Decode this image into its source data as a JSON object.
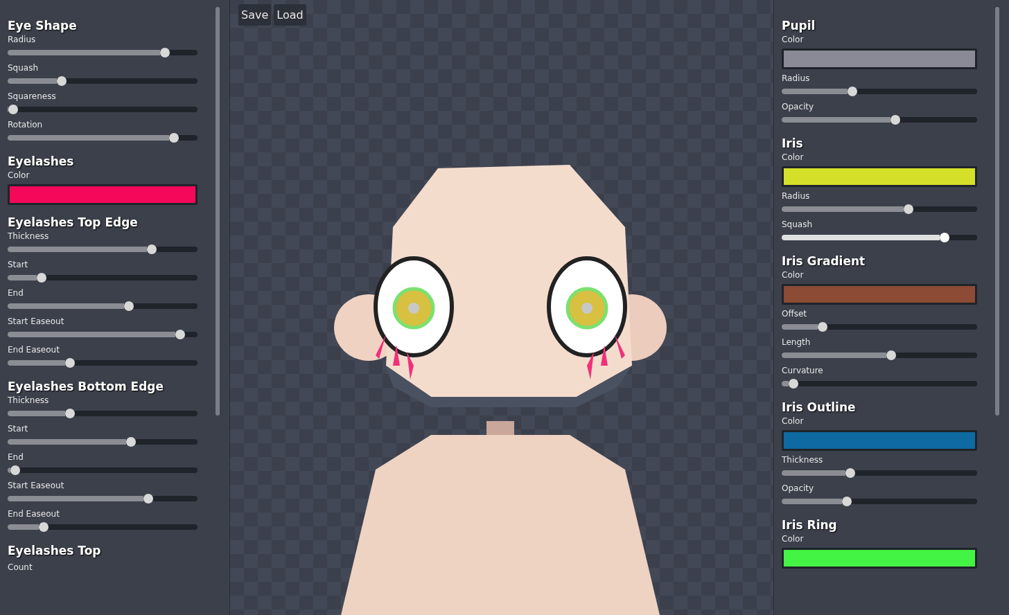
{
  "left_panel": {
    "sections": [
      {
        "title": "Eye Shape",
        "controls": [
          {
            "kind": "slider",
            "label": "Radius",
            "level": 0.83,
            "active": false
          },
          {
            "kind": "slider",
            "label": "Squash",
            "level": 0.285,
            "active": false
          },
          {
            "kind": "slider",
            "label": "Squareness",
            "level": 0.03,
            "active": false
          },
          {
            "kind": "slider",
            "label": "Rotation",
            "level": 0.875,
            "active": false
          }
        ]
      },
      {
        "title": "Eyelashes",
        "controls": [
          {
            "kind": "color",
            "label": "Color",
            "color": "#f5075a"
          }
        ]
      },
      {
        "title": "Eyelashes Top Edge",
        "controls": [
          {
            "kind": "slider",
            "label": "Thickness",
            "level": 0.76,
            "active": false
          },
          {
            "kind": "slider",
            "label": "Start",
            "level": 0.18,
            "active": false
          },
          {
            "kind": "slider",
            "label": "End",
            "level": 0.64,
            "active": false
          },
          {
            "kind": "slider",
            "label": "Start Easeout",
            "level": 0.91,
            "active": false
          },
          {
            "kind": "slider",
            "label": "End Easeout",
            "level": 0.33,
            "active": false
          }
        ]
      },
      {
        "title": "Eyelashes Bottom Edge",
        "controls": [
          {
            "kind": "slider",
            "label": "Thickness",
            "level": 0.33,
            "active": false
          },
          {
            "kind": "slider",
            "label": "Start",
            "level": 0.65,
            "active": false
          },
          {
            "kind": "slider",
            "label": "End",
            "level": 0.04,
            "active": false
          },
          {
            "kind": "slider",
            "label": "Start Easeout",
            "level": 0.74,
            "active": false
          },
          {
            "kind": "slider",
            "label": "End Easeout",
            "level": 0.19,
            "active": false
          }
        ]
      },
      {
        "title": "Eyelashes Top",
        "controls": [
          {
            "kind": "label",
            "label": "Count"
          }
        ]
      }
    ]
  },
  "viewport": {
    "buttons": [
      "Save",
      "Load"
    ]
  },
  "right_panel": {
    "sections": [
      {
        "title": "Pupil",
        "controls": [
          {
            "kind": "color",
            "label": "Color",
            "color": "#8a8a96"
          },
          {
            "kind": "slider",
            "label": "Radius",
            "level": 0.36,
            "active": false
          },
          {
            "kind": "slider",
            "label": "Opacity",
            "level": 0.58,
            "active": false
          }
        ]
      },
      {
        "title": "Iris",
        "controls": [
          {
            "kind": "color",
            "label": "Color",
            "color": "#d4e02a"
          },
          {
            "kind": "slider",
            "label": "Radius",
            "level": 0.65,
            "active": false
          },
          {
            "kind": "slider",
            "label": "Squash",
            "level": 0.835,
            "active": true
          }
        ]
      },
      {
        "title": "Iris Gradient",
        "controls": [
          {
            "kind": "color",
            "label": "Color",
            "color": "#8b4b35"
          },
          {
            "kind": "slider",
            "label": "Offset",
            "level": 0.21,
            "active": false
          },
          {
            "kind": "slider",
            "label": "Length",
            "level": 0.56,
            "active": false
          },
          {
            "kind": "slider",
            "label": "Curvature",
            "level": 0.06,
            "active": false
          }
        ]
      },
      {
        "title": "Iris Outline",
        "controls": [
          {
            "kind": "color",
            "label": "Color",
            "color": "#0e6aa0"
          },
          {
            "kind": "slider",
            "label": "Thickness",
            "level": 0.35,
            "active": false
          },
          {
            "kind": "slider",
            "label": "Opacity",
            "level": 0.335,
            "active": false
          }
        ]
      },
      {
        "title": "Iris Ring",
        "controls": [
          {
            "kind": "color",
            "label": "Color",
            "color": "#44f444"
          }
        ]
      }
    ]
  }
}
